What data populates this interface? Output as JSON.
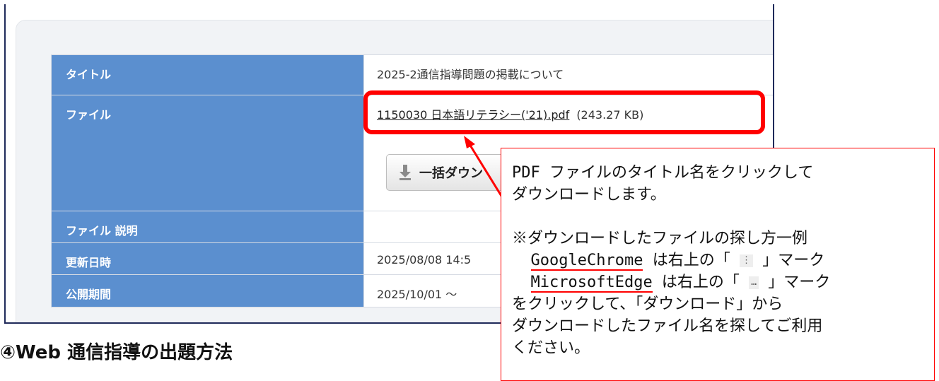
{
  "table": {
    "rows": [
      {
        "label": "タイトル",
        "value": "2025-2通信指導問題の掲載について"
      },
      {
        "label": "ファイル",
        "file_link": "1150030 日本語リテラシー('21).pdf",
        "file_size": "(243.27 KB)"
      },
      {
        "label": "ファイル 説明",
        "value": ""
      },
      {
        "label": "更新日時",
        "value": "2025/08/08 14:5"
      },
      {
        "label": "公開期間",
        "value": "2025/10/01  ～"
      }
    ],
    "download_button": "一括ダウン"
  },
  "section_heading": "④Web 通信指導の出題方法",
  "callout": {
    "line1": "PDF ファイルのタイトル名をクリックして",
    "line2": "ダウンロードします。",
    "line3": "※ダウンロードしたファイルの探し方一例",
    "chrome_name": "GoogleChrome",
    "chrome_text_a": " は右上の「 ",
    "chrome_symbol": "⋮",
    "chrome_text_b": " 」マーク",
    "edge_name": "MicrosoftEdge",
    "edge_text_a": " は右上の「 ",
    "edge_symbol": "…",
    "edge_text_b": " 」マーク",
    "line6": "をクリックして、「ダウンロード」から",
    "line7": "ダウンロードしたファイル名を探してご利用",
    "line8": "ください。"
  },
  "colors": {
    "label_bg": "#5b8fcf",
    "highlight": "#ff0000",
    "frame": "#1f2a5a"
  }
}
